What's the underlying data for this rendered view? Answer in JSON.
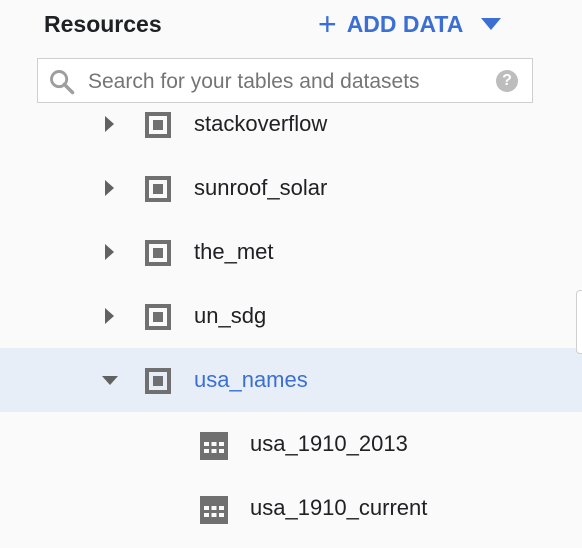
{
  "header": {
    "title": "Resources",
    "add_data_label": "ADD DATA"
  },
  "search": {
    "placeholder": "Search for your tables and datasets",
    "value": ""
  },
  "datasets": [
    {
      "name": "stackoverflow",
      "expanded": false
    },
    {
      "name": "sunroof_solar",
      "expanded": false
    },
    {
      "name": "the_met",
      "expanded": false
    },
    {
      "name": "un_sdg",
      "expanded": false
    },
    {
      "name": "usa_names",
      "expanded": true,
      "selected": true,
      "tables": [
        {
          "name": "usa_1910_2013"
        },
        {
          "name": "usa_1910_current"
        }
      ]
    }
  ],
  "colors": {
    "accent": "#3b6fd4",
    "selected_bg": "#e8eef8",
    "icon": "#707070"
  }
}
